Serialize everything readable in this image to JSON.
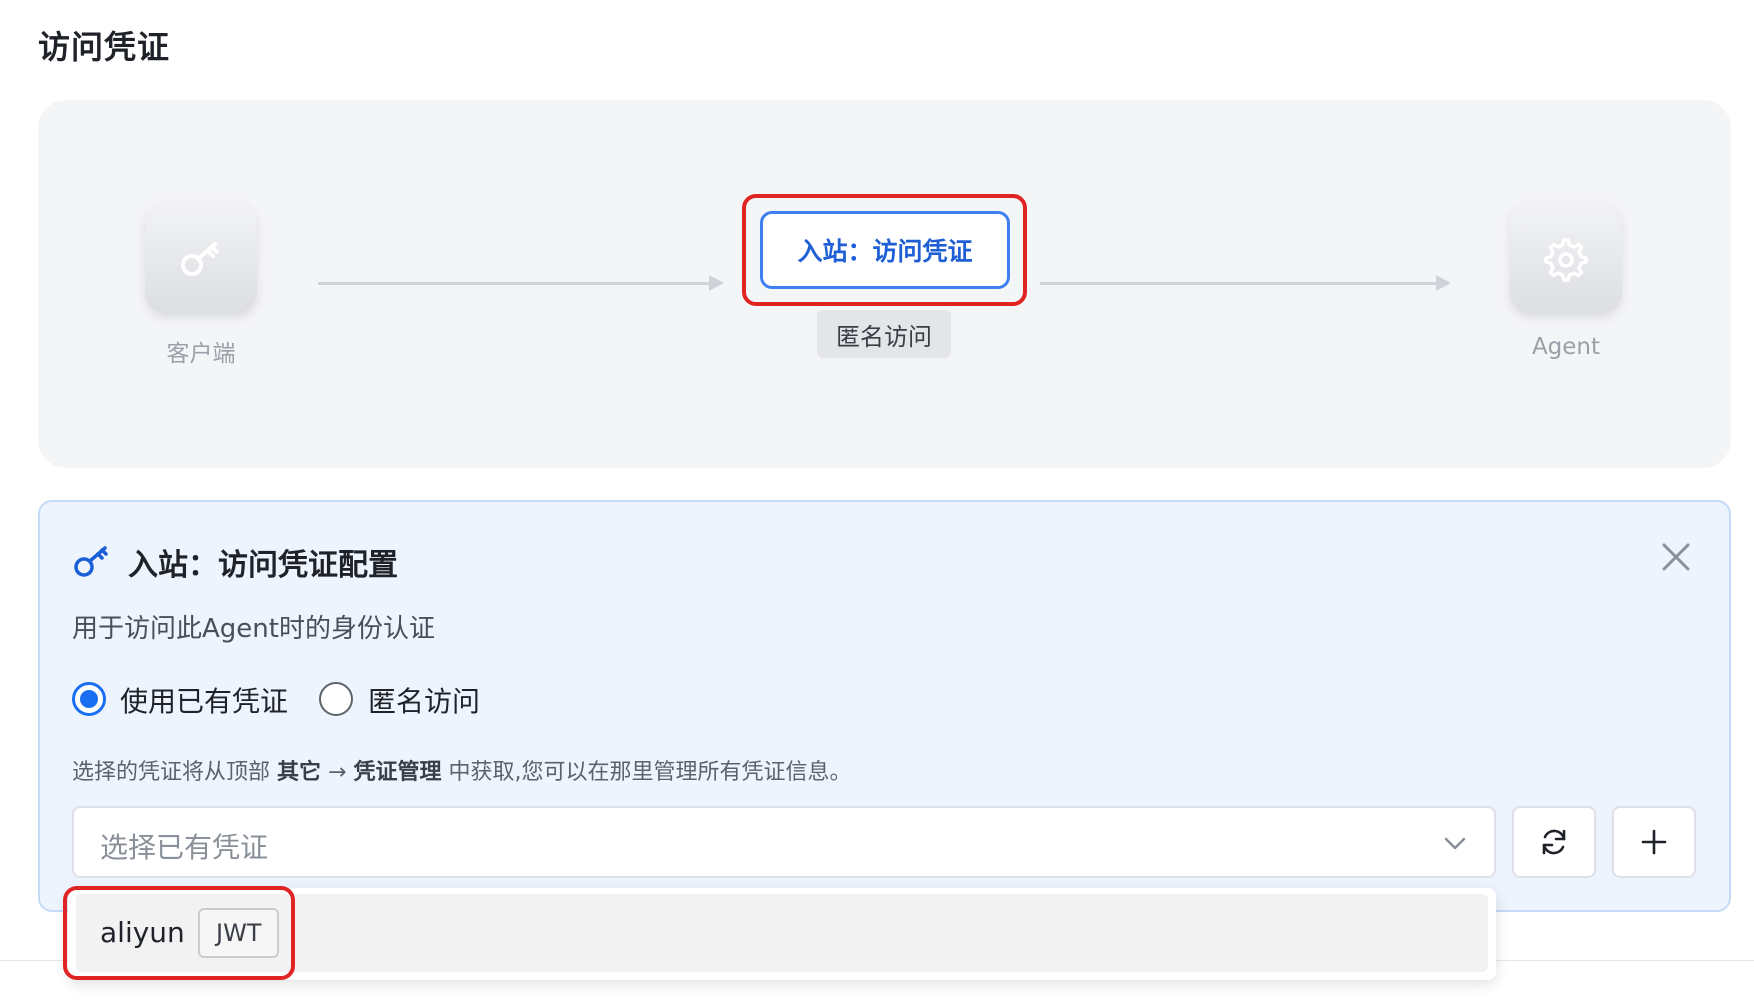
{
  "page": {
    "title": "访问凭证"
  },
  "flow": {
    "client_label": "客户端",
    "agent_label": "Agent",
    "inbound_button": "入站：访问凭证",
    "inbound_status": "匿名访问"
  },
  "config": {
    "title": "入站：访问凭证配置",
    "description": "用于访问此Agent时的身份认证",
    "radio_options": [
      {
        "label": "使用已有凭证",
        "checked": true
      },
      {
        "label": "匿名访问",
        "checked": false
      }
    ],
    "hint": {
      "prefix": "选择的凭证将从顶部 ",
      "path_1": "其它",
      "arrow": " → ",
      "path_2": "凭证管理",
      "suffix": " 中获取,您可以在那里管理所有凭证信息。"
    },
    "select": {
      "placeholder": "选择已有凭证"
    },
    "dropdown_options": [
      {
        "name": "aliyun",
        "tag": "JWT"
      }
    ]
  },
  "colors": {
    "accent": "#1a6ef2",
    "highlight": "#e02424",
    "panel_bg": "#eef4fd"
  },
  "icons": {
    "client": "key-icon",
    "agent": "gear-icon",
    "config": "key-icon",
    "close": "close-icon",
    "select": "chevron-down-icon",
    "refresh": "refresh-icon",
    "add": "plus-icon"
  }
}
